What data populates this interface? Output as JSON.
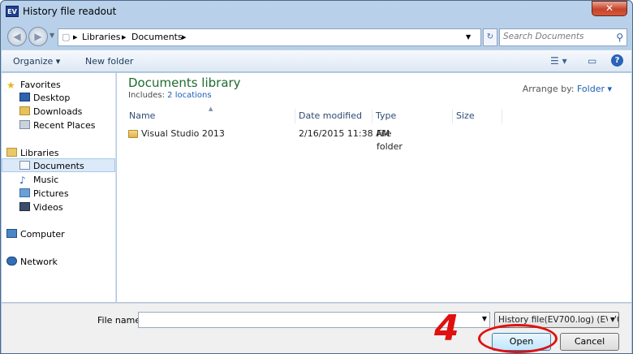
{
  "window": {
    "title": "History file readout",
    "app_icon": "EV",
    "close_glyph": "✕"
  },
  "address": {
    "breadcrumbs": [
      "Libraries",
      "Documents"
    ],
    "search_placeholder": "Search Documents"
  },
  "toolbar": {
    "organize_label": "Organize ▾",
    "new_folder_label": "New folder"
  },
  "sidebar": {
    "favorites_label": "Favorites",
    "favorites": [
      "Desktop",
      "Downloads",
      "Recent Places"
    ],
    "libraries_label": "Libraries",
    "libraries": [
      "Documents",
      "Music",
      "Pictures",
      "Videos"
    ],
    "computer_label": "Computer",
    "network_label": "Network"
  },
  "content": {
    "library_title": "Documents library",
    "includes_prefix": "Includes:",
    "includes_link": "2 locations",
    "arrange_label": "Arrange by:",
    "arrange_value": "Folder ▾",
    "columns": [
      "Name",
      "Date modified",
      "Type",
      "Size"
    ],
    "files": [
      {
        "name": "Visual Studio 2013",
        "date": "2/16/2015 11:38 AM",
        "type": "File folder",
        "size": ""
      }
    ]
  },
  "footer": {
    "file_name_label": "File name:",
    "file_name_value": "",
    "file_type_value": "History file(EV700.log) (EV700.lc",
    "open_label": "Open",
    "cancel_label": "Cancel"
  },
  "annotation": {
    "step_number": "4",
    "color": "#e01010"
  },
  "colors": {
    "library_title": "#1e6b2f",
    "link": "#1b5fb5",
    "selected_nav": "#dbe9f8"
  }
}
